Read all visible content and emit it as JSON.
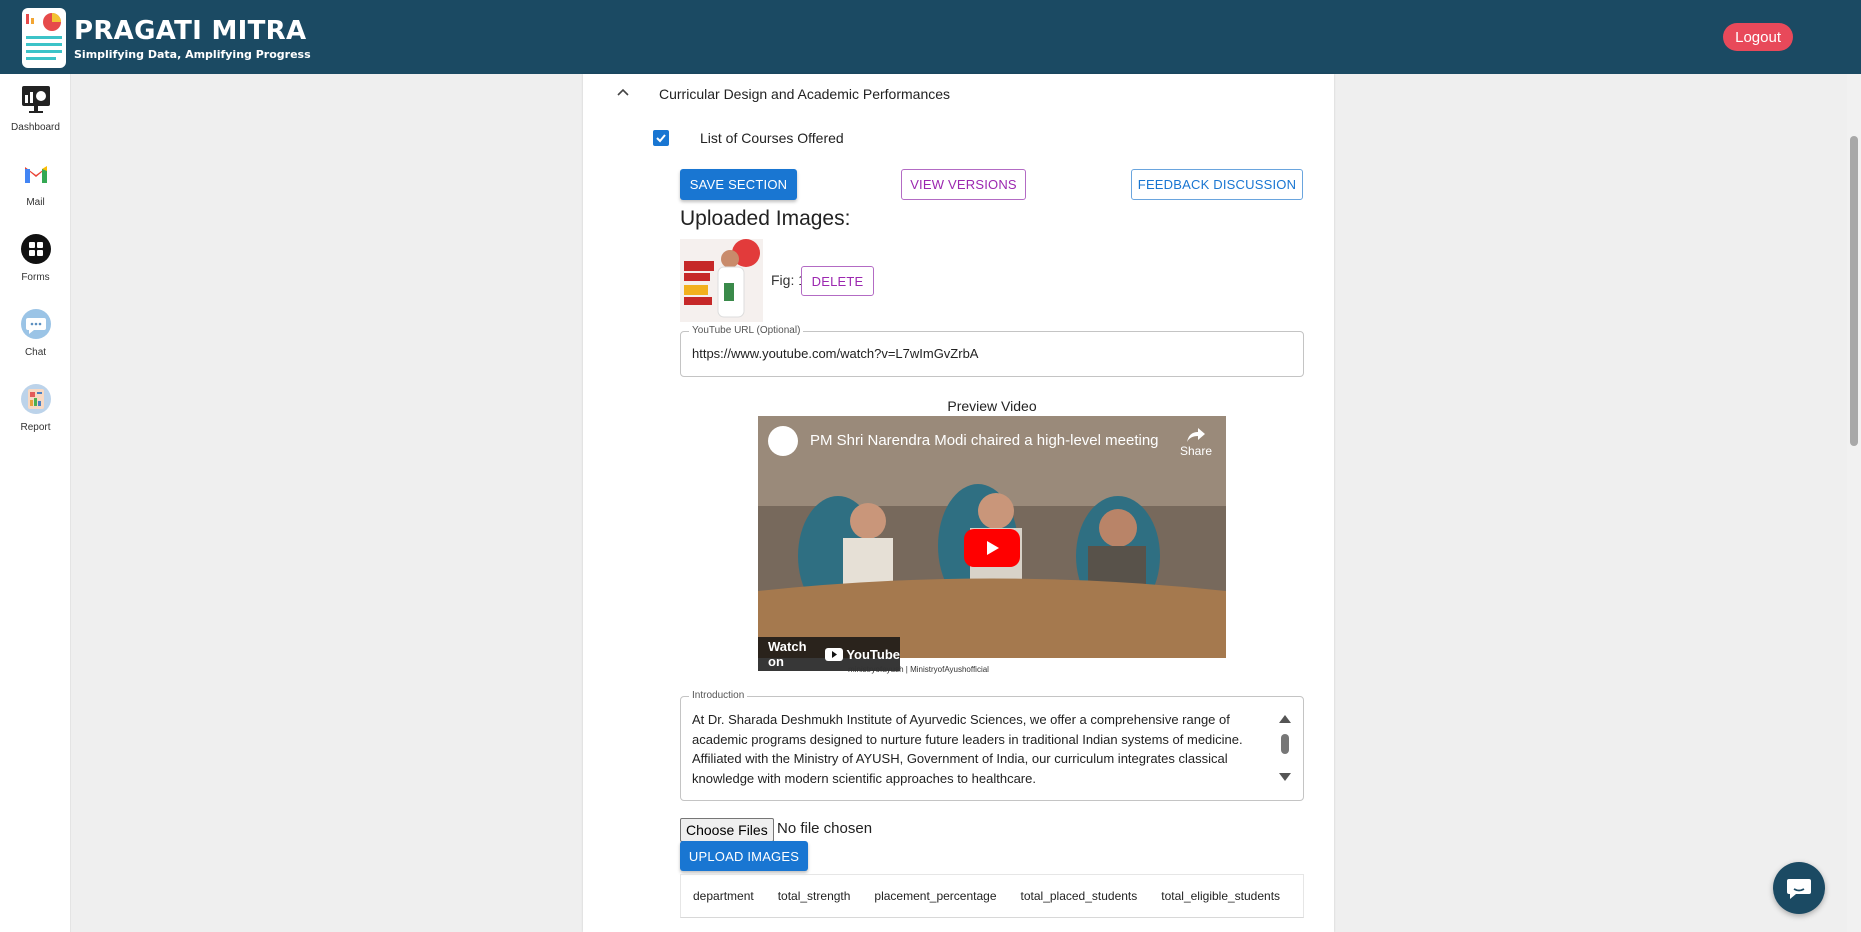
{
  "header": {
    "brand_title": "PRAGATI MITRA",
    "brand_subtitle": "Simplifying Data, Amplifying Progress",
    "logout_label": "Logout"
  },
  "sidebar": {
    "items": [
      {
        "label": "Dashboard",
        "icon": "dashboard-icon"
      },
      {
        "label": "Mail",
        "icon": "gmail-icon"
      },
      {
        "label": "Forms",
        "icon": "forms-icon"
      },
      {
        "label": "Chat",
        "icon": "chat-icon"
      },
      {
        "label": "Report",
        "icon": "report-icon"
      }
    ]
  },
  "section": {
    "title": "Curricular Design and Academic Performances",
    "checkbox_label": "List of Courses Offered",
    "checked": true
  },
  "actions": {
    "save_label": "SAVE SECTION",
    "versions_label": "VIEW VERSIONS",
    "feedback_label": "FEEDBACK DISCUSSION"
  },
  "uploads": {
    "title": "Uploaded Images:",
    "fig_label": "Fig: 1",
    "delete_label": "DELETE"
  },
  "youtube": {
    "label": "YouTube URL (Optional)",
    "value": "https://www.youtube.com/watch?v=L7wImGvZrbA"
  },
  "preview": {
    "label": "Preview Video",
    "video_title": "PM Shri Narendra Modi chaired a high-level meeting",
    "share_label": "Share",
    "watch_label": "Watch on",
    "youtube_brand": "YouTube",
    "social_text": "ministryofayush  |  MinistryofAyushofficial"
  },
  "introduction": {
    "label": "Introduction",
    "text": "At Dr. Sharada Deshmukh Institute of Ayurvedic Sciences, we offer a comprehensive range of academic programs designed to nurture future leaders in traditional Indian systems of medicine. Affiliated with the Ministry of AYUSH, Government of India, our curriculum integrates classical knowledge with modern scientific approaches to healthcare."
  },
  "file_input": {
    "button_label": "Choose Files",
    "status": "No file chosen",
    "upload_label": "UPLOAD IMAGES"
  },
  "table": {
    "columns": [
      "department",
      "total_strength",
      "placement_percentage",
      "total_placed_students",
      "total_eligible_students"
    ]
  },
  "colors": {
    "header_bg": "#1b4a63",
    "primary": "#1976d2",
    "secondary": "#9c27b0",
    "logout": "#e8495a"
  }
}
